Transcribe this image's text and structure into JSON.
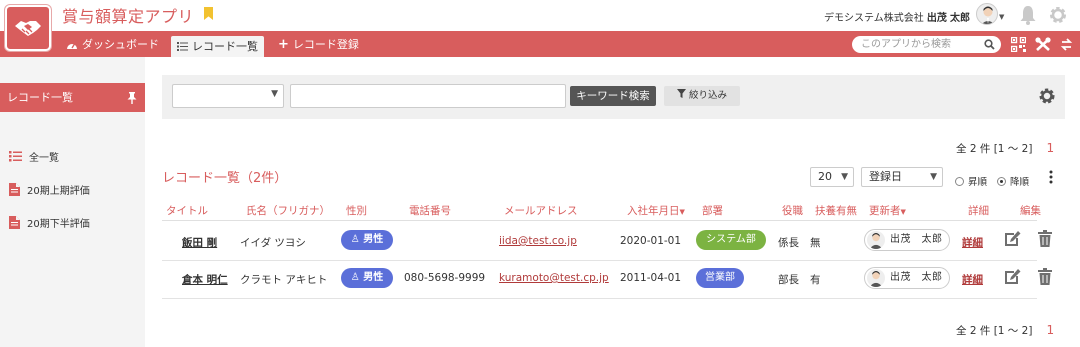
{
  "app": {
    "title": "賞与額算定アプリ"
  },
  "user": {
    "company": "デモシステム株式会社",
    "surname": "出茂",
    "given": "太郎"
  },
  "nav": {
    "dashboard": "ダッシュボード",
    "record_list": "レコード一覧",
    "record_add": "レコード登録",
    "search_placeholder": "このアプリから検索"
  },
  "sidebar": {
    "heading": "レコード一覧",
    "items": [
      {
        "label": "全一覧"
      },
      {
        "label": "20期上期評価"
      },
      {
        "label": "20期下半評価"
      }
    ]
  },
  "toolbar": {
    "keyword_button": "キーワード検索",
    "filter_button": "絞り込み",
    "select_value": "",
    "keyword_value": ""
  },
  "pager": {
    "summary": "全 2 件 [1 ～ 2]",
    "page": "1"
  },
  "list": {
    "title": "レコード一覧（2件）",
    "per_page": "20",
    "sort_field": "登録日",
    "asc_label": "昇順",
    "desc_label": "降順",
    "order": "desc"
  },
  "table": {
    "headers": {
      "title": "タイトル",
      "name_kana": "氏名（フリガナ）",
      "gender": "性別",
      "phone": "電話番号",
      "email": "メールアドレス",
      "join_date": "入社年月日",
      "dept": "部署",
      "role": "役職",
      "dependents": "扶養有無",
      "updater": "更新者",
      "detail": "詳細",
      "edit": "編集"
    },
    "rows": [
      {
        "name": "飯田 剛",
        "kana": "イイダ ツヨシ",
        "gender": "男性",
        "phone": "",
        "email": "iida@test.co.jp",
        "join_date": "2020-01-01",
        "dept": "システム部",
        "dept_color": "#7cb342",
        "role": "係長",
        "dependents": "無",
        "updater": "出茂　太郎",
        "detail": "詳細"
      },
      {
        "name": "倉本 明仁",
        "kana": "クラモト アキヒト",
        "gender": "男性",
        "phone": "080-5698-9999",
        "email": "kuramoto@test.cp.jp",
        "join_date": "2011-04-01",
        "dept": "営業部",
        "dept_color": "#5b6fd9",
        "role": "部長",
        "dependents": "有",
        "updater": "出茂　太郎",
        "detail": "詳細"
      }
    ]
  },
  "colors": {
    "brand": "#d85d5d",
    "gender_badge": "#5b6fd9",
    "link": "#b03a3a"
  }
}
